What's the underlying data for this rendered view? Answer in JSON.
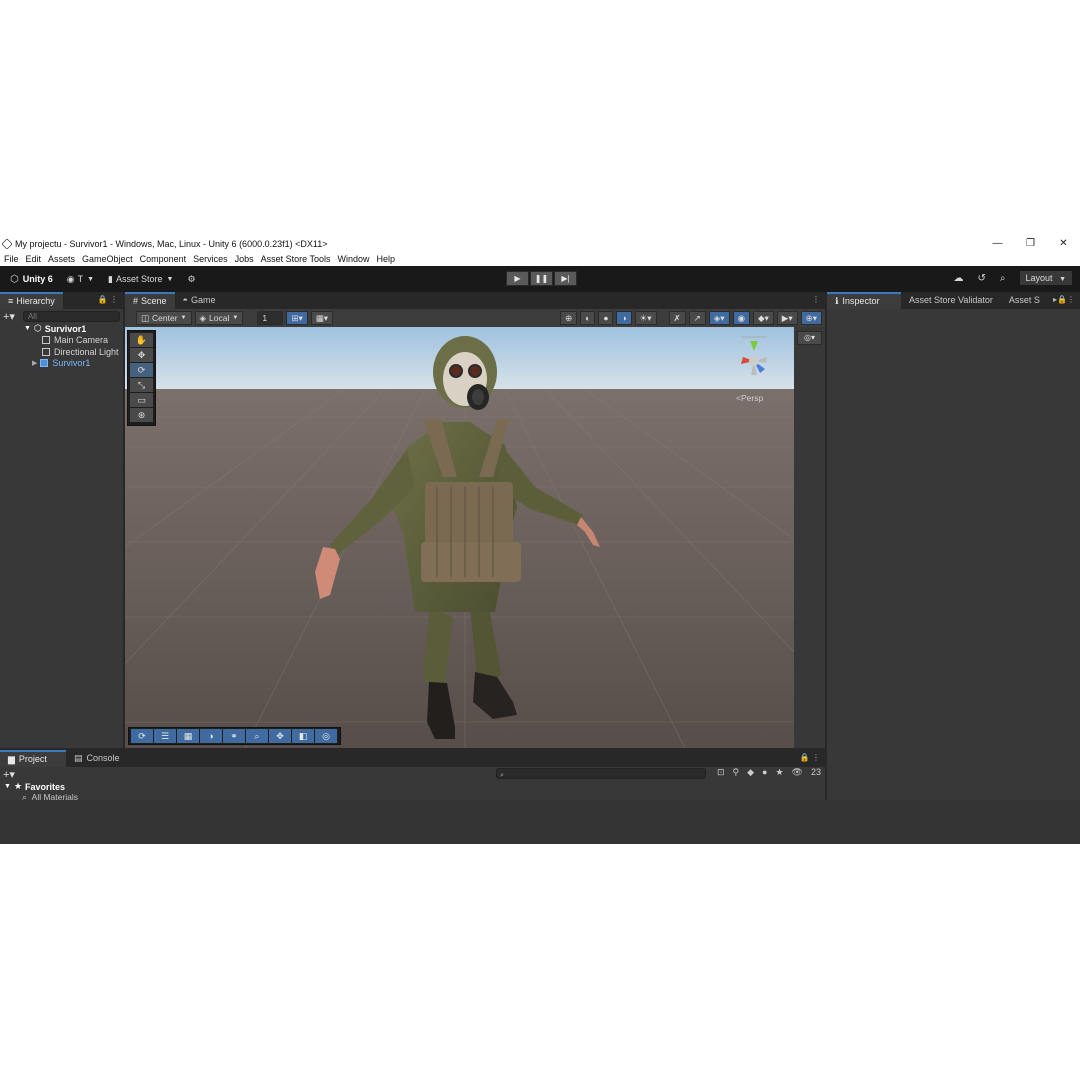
{
  "window": {
    "title": "My projectu - Survivor1 - Windows, Mac, Linux - Unity 6 (6000.0.23f1) <DX11>",
    "controls": [
      "—",
      "❐",
      "✕"
    ]
  },
  "menu": [
    "File",
    "Edit",
    "Assets",
    "GameObject",
    "Component",
    "Services",
    "Jobs",
    "Asset Store Tools",
    "Window",
    "Help"
  ],
  "toolbar": {
    "unity_label": "Unity 6",
    "account_label": "T",
    "asset_store_label": "Asset Store",
    "play": "▶",
    "pause": "❚❚",
    "step": "▶|",
    "layout_label": "Layout"
  },
  "hierarchy": {
    "tab_label": "Hierarchy",
    "search_placeholder": "All",
    "items": [
      {
        "label": "Survivor1",
        "kind": "root"
      },
      {
        "label": "Main Camera",
        "kind": "child"
      },
      {
        "label": "Directional Light",
        "kind": "child"
      },
      {
        "label": "Survivor1",
        "kind": "prefab"
      }
    ]
  },
  "scene": {
    "tabs": [
      "Scene",
      "Game"
    ],
    "pivot_label": "Center",
    "space_label": "Local",
    "grid_value": "1",
    "persp_label": "<Persp"
  },
  "inspector": {
    "tabs": [
      "Inspector",
      "Asset Store Validator",
      "Asset S"
    ]
  },
  "project": {
    "tabs": [
      "Project",
      "Console"
    ],
    "favorites_label": "Favorites",
    "favorites_child": "All Materials",
    "count": "23"
  },
  "colors": {
    "accent": "#3a79bb",
    "panel": "#383838",
    "toolbar": "#191919",
    "sky": "#b8d4e8",
    "ground": "#5d5450"
  }
}
